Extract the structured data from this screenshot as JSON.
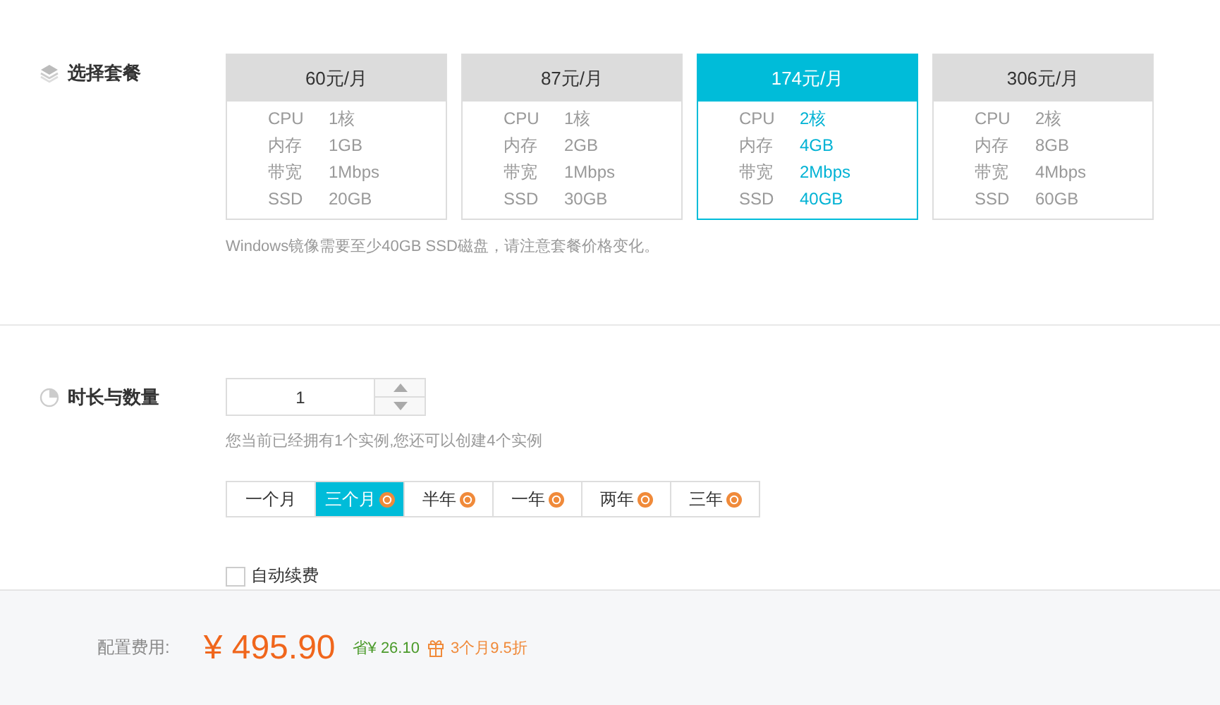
{
  "plan_section": {
    "title": "选择套餐",
    "plans": [
      {
        "price": "60元/月",
        "selected": false,
        "specs": [
          {
            "label": "CPU",
            "value": "1核"
          },
          {
            "label": "内存",
            "value": "1GB"
          },
          {
            "label": "带宽",
            "value": "1Mbps"
          },
          {
            "label": "SSD",
            "value": "20GB"
          }
        ]
      },
      {
        "price": "87元/月",
        "selected": false,
        "specs": [
          {
            "label": "CPU",
            "value": "1核"
          },
          {
            "label": "内存",
            "value": "2GB"
          },
          {
            "label": "带宽",
            "value": "1Mbps"
          },
          {
            "label": "SSD",
            "value": "30GB"
          }
        ]
      },
      {
        "price": "174元/月",
        "selected": true,
        "specs": [
          {
            "label": "CPU",
            "value": "2核"
          },
          {
            "label": "内存",
            "value": "4GB"
          },
          {
            "label": "带宽",
            "value": "2Mbps"
          },
          {
            "label": "SSD",
            "value": "40GB"
          }
        ]
      },
      {
        "price": "306元/月",
        "selected": false,
        "specs": [
          {
            "label": "CPU",
            "value": "2核"
          },
          {
            "label": "内存",
            "value": "8GB"
          },
          {
            "label": "带宽",
            "value": "4Mbps"
          },
          {
            "label": "SSD",
            "value": "60GB"
          }
        ]
      }
    ],
    "note": "Windows镜像需要至少40GB SSD磁盘，请注意套餐价格变化。"
  },
  "duration_section": {
    "title": "时长与数量",
    "quantity": "1",
    "info": "您当前已经拥有1个实例,您还可以创建4个实例",
    "periods": [
      {
        "label": "一个月",
        "selected": false,
        "discount": false
      },
      {
        "label": "三个月",
        "selected": true,
        "discount": true
      },
      {
        "label": "半年",
        "selected": false,
        "discount": true
      },
      {
        "label": "一年",
        "selected": false,
        "discount": true
      },
      {
        "label": "两年",
        "selected": false,
        "discount": true
      },
      {
        "label": "三年",
        "selected": false,
        "discount": true
      }
    ],
    "auto_renew": {
      "label": "自动续费",
      "checked": false
    }
  },
  "footer": {
    "label": "配置费用:",
    "price": "¥ 495.90",
    "saving": "省¥ 26.10",
    "promo": "3个月9.5折"
  }
}
